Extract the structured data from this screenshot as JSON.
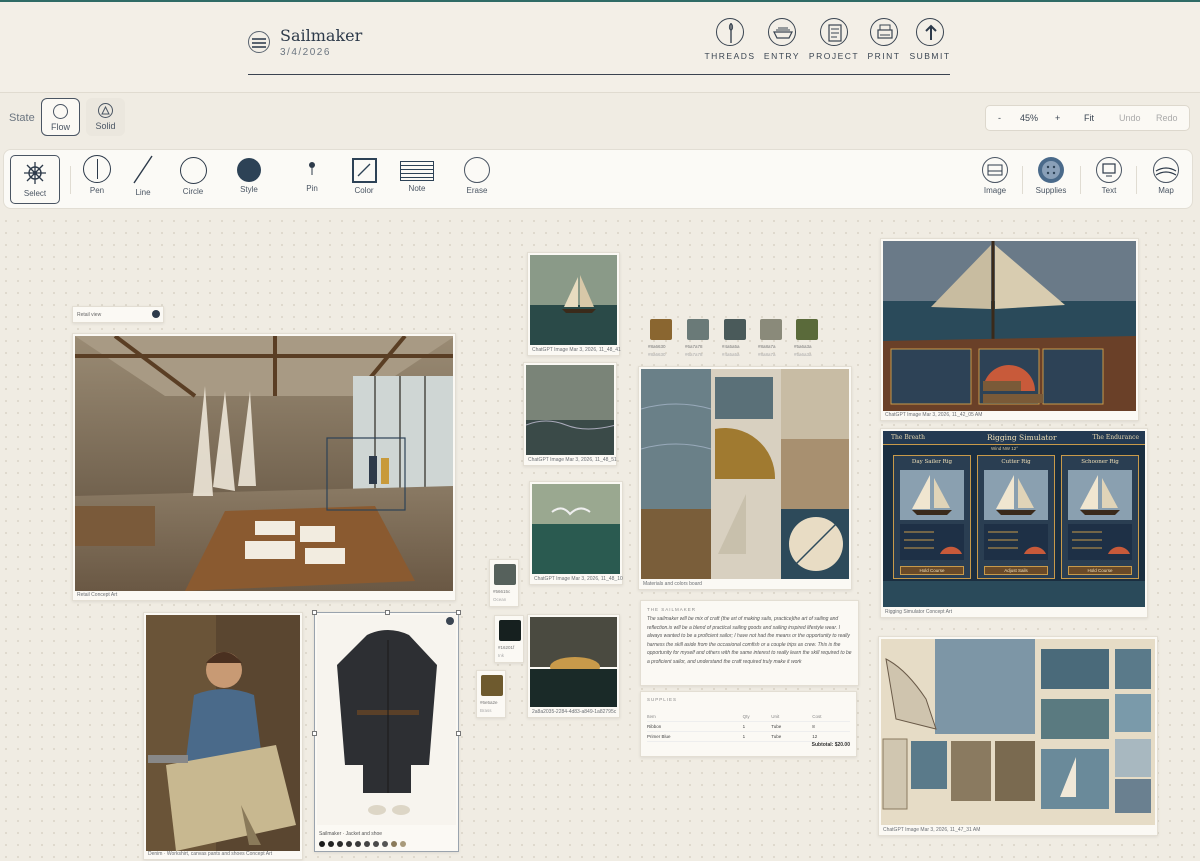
{
  "header": {
    "title": "Sailmaker",
    "date": "3/4/2026",
    "nav": [
      {
        "label": "THREADS",
        "icon": "needle-icon"
      },
      {
        "label": "ENTRY",
        "icon": "boat-hull-icon"
      },
      {
        "label": "PROJECT",
        "icon": "blueprint-icon"
      },
      {
        "label": "PRINT",
        "icon": "printer-icon"
      },
      {
        "label": "SUBMIT",
        "icon": "arrow-up-icon"
      }
    ]
  },
  "state": {
    "label": "State",
    "options": [
      {
        "label": "Flow",
        "icon": "waves-icon",
        "active": true
      },
      {
        "label": "Solid",
        "icon": "triangle-icon",
        "active": false
      }
    ]
  },
  "zoom": {
    "minus": "-",
    "value": "45%",
    "plus": "+",
    "fit": "Fit",
    "undo": "Undo",
    "redo": "Redo"
  },
  "toolbar": {
    "tools": [
      {
        "label": "Select",
        "icon": "ship-wheel-icon"
      },
      {
        "label": "Pen",
        "icon": "pen-icon"
      },
      {
        "label": "Line",
        "icon": "line-icon"
      },
      {
        "label": "Circle",
        "icon": "circle-icon"
      },
      {
        "label": "Style",
        "icon": "style-icon"
      },
      {
        "label": "Pin",
        "icon": "pin-icon"
      },
      {
        "label": "Color",
        "icon": "color-picker-icon"
      },
      {
        "label": "Note",
        "icon": "note-icon"
      },
      {
        "label": "Erase",
        "icon": "eraser-icon"
      }
    ],
    "right_tools": [
      {
        "label": "Image",
        "icon": "image-icon"
      },
      {
        "label": "Supplies",
        "icon": "supplies-icon"
      },
      {
        "label": "Text",
        "icon": "text-monitor-icon"
      },
      {
        "label": "Map",
        "icon": "map-globe-icon"
      }
    ]
  },
  "canvas": {
    "small_label": {
      "text": "Retail view"
    },
    "retail": {
      "caption": "Retail Concept Art"
    },
    "denim": {
      "caption": "Denim · Workshirt, canvas pants and shoes Concept Art"
    },
    "coat": {
      "caption": "Sailmaker · Jacket and shoe"
    },
    "sail1": {
      "caption": "ChatGPT Image Mar 3, 2026, 11_48_41"
    },
    "sail2": {
      "caption": "ChatGPT Image Mar 3, 2026, 11_48_51"
    },
    "gull": {
      "caption": "ChatGPT Image Mar 3, 2026, 11_48_10"
    },
    "sunset": {
      "caption": "2a8a2035-2284-4d83-a849-1a82795c"
    },
    "deck": {
      "caption": "ChatGPT Image Mar 3, 2026, 11_42_05 AM"
    },
    "rigging": {
      "caption": "Rigging Simulator Concept Art",
      "title": "Rigging Simulator",
      "left_tab": "The Breath",
      "right_tab": "The Endurance",
      "wind": "Wind NW 12°",
      "panels": [
        "Day Sailer Rig",
        "Cutter Rig",
        "Schooner Rig"
      ],
      "buttons": [
        "Hold Course",
        "Adjust Sails",
        "Hold Course"
      ]
    },
    "sketch": {
      "caption": "ChatGPT Image Mar 3, 2026, 11_47_31 AM"
    },
    "moodboard": {
      "caption": "Materials and colors board"
    },
    "palette": [
      {
        "hex": "#8a6630",
        "label": "#8a6630",
        "sub": "#8a6630"
      },
      {
        "hex": "#6a7a78",
        "label": "#6a7a78",
        "sub": "#6a7a78"
      },
      {
        "hex": "#4a5a5a",
        "label": "#4a5a5a",
        "sub": "#4a5a5a"
      },
      {
        "hex": "#8a8a7a",
        "label": "#8a8a7a",
        "sub": "#8a8a7a"
      },
      {
        "hex": "#5a6a3a",
        "label": "#5a6a3a",
        "sub": "#5a6a3a"
      }
    ],
    "loose_swatches": [
      {
        "hex": "#56615c",
        "label": "#56615c",
        "sub": "Ocean"
      },
      {
        "hex": "#16201f",
        "label": "#16201f",
        "sub": "Ink"
      },
      {
        "hex": "#6e5a2e",
        "label": "#6e5a2e",
        "sub": "Brass"
      }
    ],
    "coat_dots": [
      "#1a1a1a",
      "#222",
      "#2a2a2a",
      "#333",
      "#3a3a3a",
      "#444",
      "#4a4a4a",
      "#555",
      "#8a7a5a",
      "#a89a7a"
    ],
    "sail_note": {
      "title": "THE SAILMAKER",
      "body": "The sailmaker will be mix of craft (the art of making sails, practice)the art of sailing and reflection.is will be a blend of practical sailing goods and sailing inspired lifestyle wear. I always wanted to be a proficient sailor; I have not had the means or the opportunity to really harness the skill aside from the occasional comfish or a couple trips as crew. This is the opportunity for myself and others with the same interest to really learn the skill required to be a proficient sailor, and understand the craft required truly make it work"
    },
    "supplies": {
      "title": "SUPPLIES",
      "headers": [
        "Item",
        "Qty",
        "Unit",
        "Cost"
      ],
      "rows": [
        [
          "Ribbon",
          "1",
          "Tube",
          "8"
        ],
        [
          "Primer Blue",
          "1",
          "Tube",
          "12"
        ]
      ],
      "subtotal": "Subtotal: $20.00"
    }
  }
}
